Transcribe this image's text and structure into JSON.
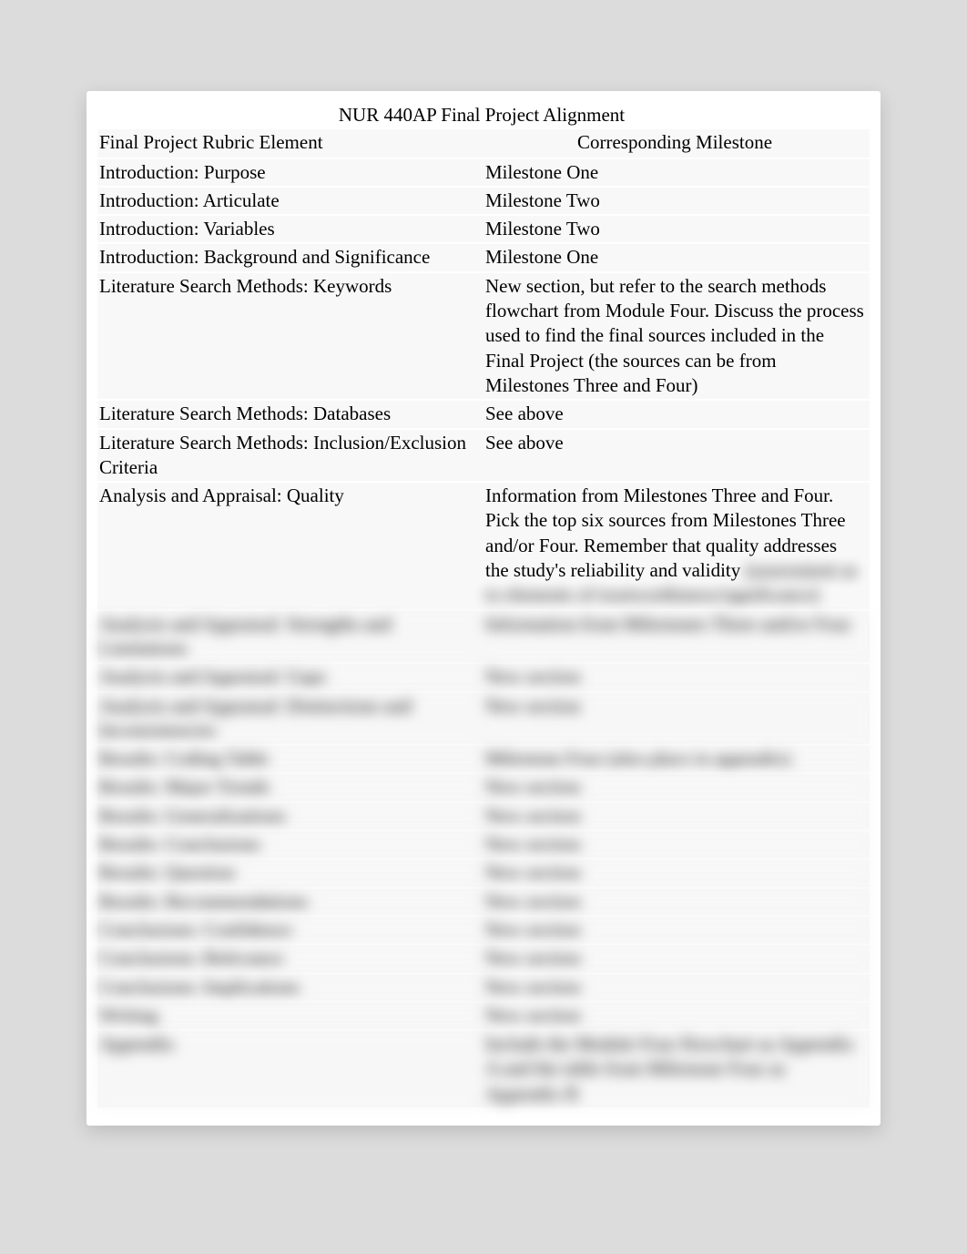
{
  "title": "NUR 440AP Final Project Alignment",
  "headers": {
    "left": "Final Project Rubric Element",
    "right": "Corresponding Milestone"
  },
  "rows": [
    {
      "element": "Introduction: Purpose",
      "milestone": "Milestone One",
      "blurred": false
    },
    {
      "element": "Introduction: Articulate",
      "milestone": "Milestone Two",
      "blurred": false
    },
    {
      "element": "Introduction: Variables",
      "milestone": "Milestone Two",
      "blurred": false
    },
    {
      "element": "Introduction: Background and Significance",
      "milestone": "Milestone One",
      "blurred": false
    },
    {
      "element": "Literature Search Methods: Keywords",
      "milestone": "New section, but refer to the search methods flowchart from Module Four. Discuss the process used to find the final sources included in the Final Project (the sources can be from Milestones Three and Four)",
      "blurred": false
    },
    {
      "element": "Literature Search Methods: Databases",
      "milestone": "See above",
      "blurred": false
    },
    {
      "element": "Literature Search Methods: Inclusion/Exclusion Criteria",
      "milestone": "See above",
      "blurred": false
    },
    {
      "element": "Analysis and Appraisal: Quality",
      "milestone": "Information from Milestones Three and Four. Pick the top six sources from Milestones Three and/or Four. Remember that quality addresses the study's reliability and validity (assessment as to elements of trustworthiness/significance)",
      "blurred": false,
      "partialBlur": true
    },
    {
      "element": "Analysis and Appraisal: Strengths and Limitations",
      "milestone": "Information from Milestones Three and/or Four",
      "blurred": true
    },
    {
      "element": "Analysis and Appraisal: Gaps",
      "milestone": "New section",
      "blurred": true
    },
    {
      "element": "Analysis and Appraisal: Distinctions and Inconsistencies",
      "milestone": "New section",
      "blurred": true
    },
    {
      "element": "Results: Coding Table",
      "milestone": "Milestone Four (also place in appendix)",
      "blurred": true
    },
    {
      "element": "Results: Major Trends",
      "milestone": "New section",
      "blurred": true
    },
    {
      "element": "Results: Generalizations",
      "milestone": "New section",
      "blurred": true
    },
    {
      "element": "Results: Conclusions",
      "milestone": "New section",
      "blurred": true
    },
    {
      "element": "Results: Question",
      "milestone": "New section",
      "blurred": true
    },
    {
      "element": "Results: Recommendations",
      "milestone": "New section",
      "blurred": true
    },
    {
      "element": "Conclusions: Confidence",
      "milestone": "New section",
      "blurred": true
    },
    {
      "element": "Conclusions: Relevance",
      "milestone": "New section",
      "blurred": true
    },
    {
      "element": "Conclusions: Implications",
      "milestone": "New section",
      "blurred": true
    },
    {
      "element": "Writing",
      "milestone": "New section",
      "blurred": true
    },
    {
      "element": "Appendix",
      "milestone": "Include the Module Four flowchart as Appendix A and the table from Milestone Four as Appendix B",
      "blurred": true
    }
  ]
}
